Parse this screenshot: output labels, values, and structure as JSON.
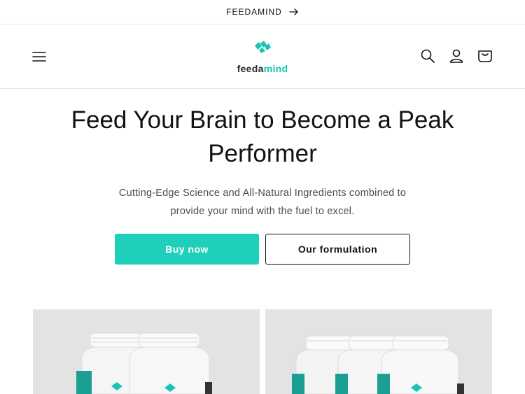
{
  "announcement": {
    "text": "FEEDAMIND",
    "icon": "arrow-right-icon"
  },
  "header": {
    "menu_icon": "hamburger-menu-icon",
    "logo": {
      "word1": "feeda",
      "word2": "mind",
      "mark_icon": "brain-logo-icon"
    },
    "icons": [
      "search-icon",
      "account-icon",
      "cart-icon"
    ]
  },
  "hero": {
    "title": "Feed Your Brain to Become a Peak Performer",
    "subtitle": "Cutting-Edge Science and All-Natural Ingredients combined to provide your mind with the fuel to excel.",
    "buy_label": "Buy now",
    "formulation_label": "Our formulation"
  },
  "products": [
    {
      "name": "two-bottle-pack",
      "bottle_count": 2
    },
    {
      "name": "three-bottle-pack",
      "bottle_count": 3
    }
  ],
  "colors": {
    "accent": "#1ecfba",
    "logo_teal": "#1cc4b3",
    "text": "#121212",
    "card_bg": "#e3e3e3",
    "border": "#e6e6e6"
  }
}
